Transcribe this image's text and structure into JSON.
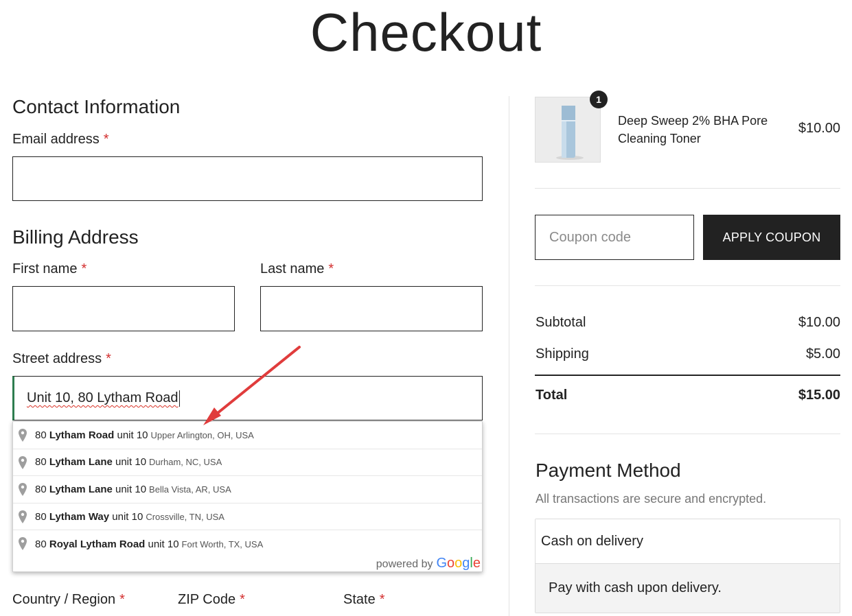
{
  "page": {
    "title": "Checkout"
  },
  "contact": {
    "heading": "Contact Information",
    "email_label": "Email address",
    "required_mark": "*"
  },
  "billing": {
    "heading": "Billing Address",
    "first_name_label": "First name",
    "last_name_label": "Last name",
    "street_label": "Street address",
    "street_value": "Unit 10, 80 Lytham Road",
    "country_label": "Country / Region",
    "zip_label": "ZIP Code",
    "state_label": "State"
  },
  "autocomplete": {
    "items": [
      {
        "num": "80",
        "street": "Lytham Road",
        "unit": "unit 10",
        "place": "Upper Arlington, OH, USA"
      },
      {
        "num": "80",
        "street": "Lytham Lane",
        "unit": "unit 10",
        "place": "Durham, NC, USA"
      },
      {
        "num": "80",
        "street": "Lytham Lane",
        "unit": "unit 10",
        "place": "Bella Vista, AR, USA"
      },
      {
        "num": "80",
        "street": "Lytham Way",
        "unit": "unit 10",
        "place": "Crossville, TN, USA"
      },
      {
        "num": "80",
        "street": "Royal Lytham Road",
        "unit": "unit 10",
        "place": "Fort Worth, TX, USA"
      }
    ],
    "powered_by": "powered by",
    "google": "Google"
  },
  "order": {
    "product_name": "Deep Sweep 2% BHA Pore Cleaning Toner",
    "product_price": "$10.00",
    "quantity": "1",
    "coupon_placeholder": "Coupon code",
    "apply_label": "APPLY COUPON",
    "subtotal_label": "Subtotal",
    "subtotal_value": "$10.00",
    "shipping_label": "Shipping",
    "shipping_value": "$5.00",
    "total_label": "Total",
    "total_value": "$15.00"
  },
  "payment": {
    "heading": "Payment Method",
    "subtitle": "All transactions are secure and encrypted.",
    "option_label": "Cash on delivery",
    "option_description": "Pay with cash upon delivery."
  },
  "colors": {
    "accent_dark": "#222222",
    "required": "#d32f2f",
    "focus_border": "#2e7d4f",
    "annotation_arrow": "#e03c3c"
  }
}
